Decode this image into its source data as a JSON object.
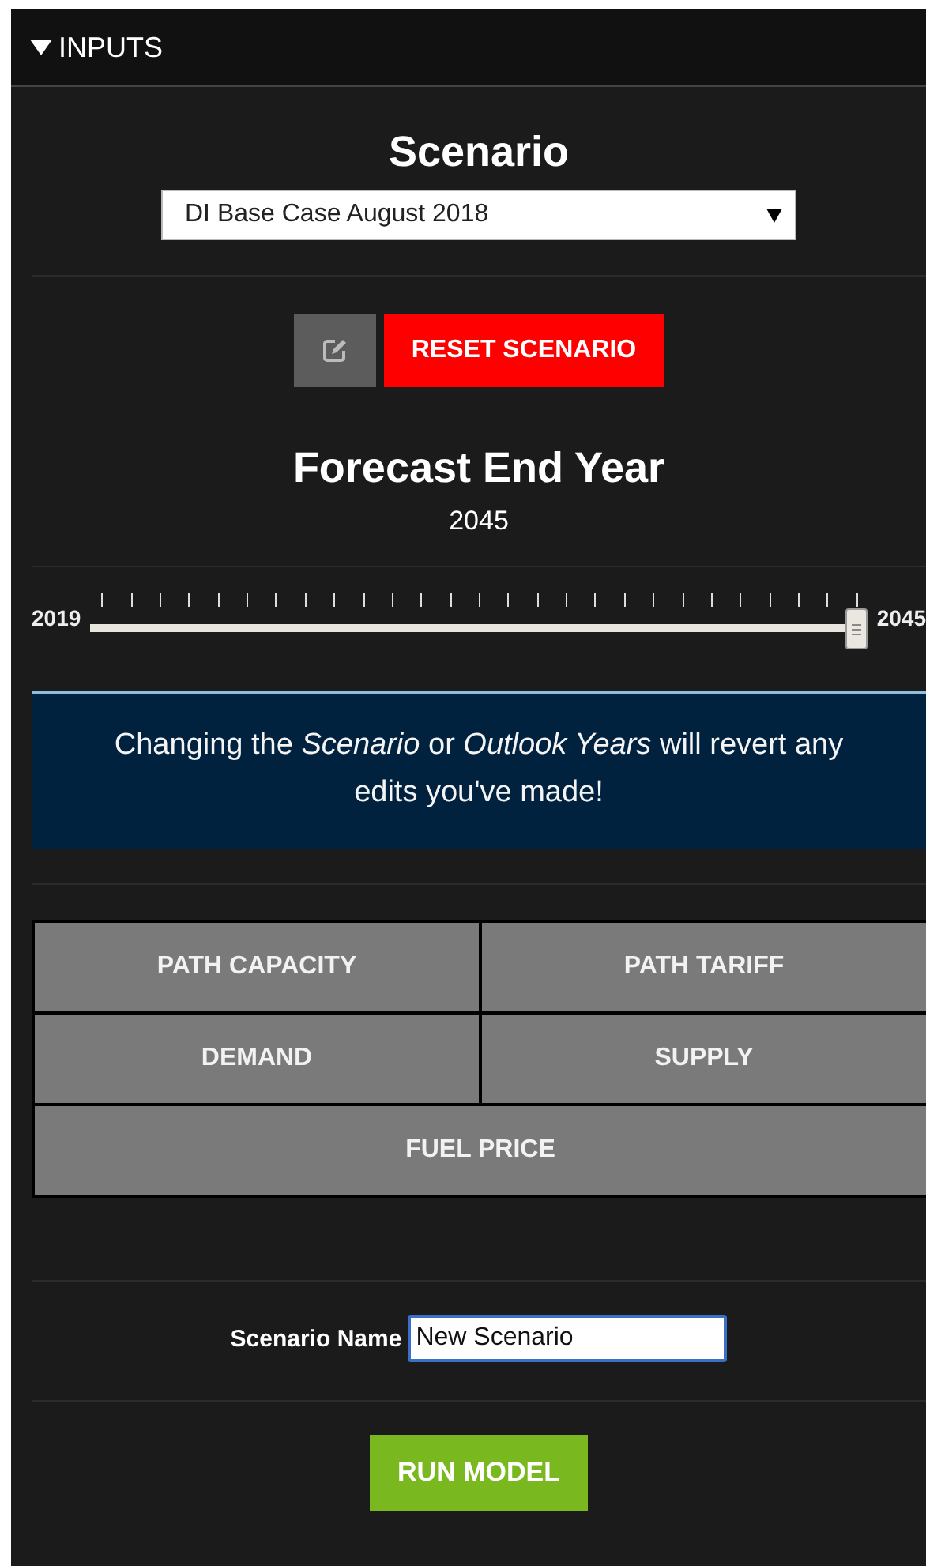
{
  "panel": {
    "title": "INPUTS",
    "expanded": true
  },
  "scenario": {
    "title": "Scenario",
    "selected_value": "DI Base Case August 2018"
  },
  "actions": {
    "reset_label": "RESET SCENARIO"
  },
  "forecast": {
    "title": "Forecast End Year",
    "value": "2045",
    "min_label": "2019",
    "max_label": "2045",
    "level": 1.0
  },
  "notice": "Changing the *Scenario* or *Outlook Years* will revert any edits you've made!",
  "editors": [
    {
      "label": "PATH CAPACITY",
      "kind": "half"
    },
    {
      "label": "PATH TARIFF",
      "kind": "half"
    },
    {
      "label": "DEMAND",
      "kind": "half"
    },
    {
      "label": "SUPPLY",
      "kind": "half"
    },
    {
      "label": "FUEL PRICE",
      "kind": "full"
    }
  ],
  "scenario_name": {
    "label": "Scenario Name",
    "value": "New Scenario"
  },
  "run_label": "RUN MODEL"
}
